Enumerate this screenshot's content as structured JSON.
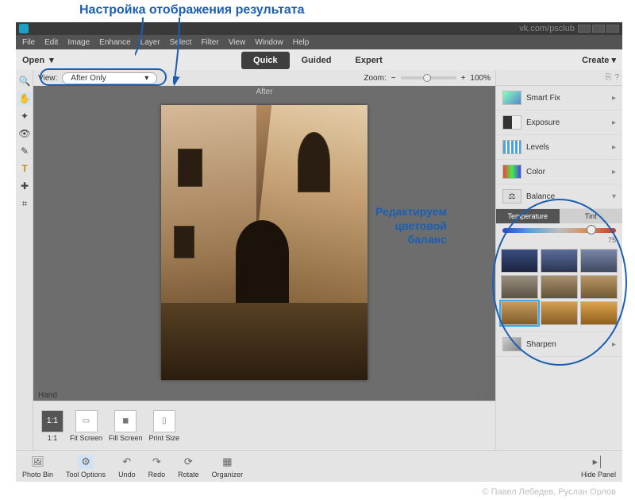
{
  "annotation": {
    "top": "Настройка отображения результата",
    "right_l1": "Редактируем",
    "right_l2": "цветовой",
    "right_l3": "баланс"
  },
  "watermark": "vk.com/psclub",
  "menu": [
    "File",
    "Edit",
    "Image",
    "Enhance",
    "Layer",
    "Select",
    "Filter",
    "View",
    "Window",
    "Help"
  ],
  "modebar": {
    "open": "Open",
    "tabs": [
      "Quick",
      "Guided",
      "Expert"
    ],
    "active": "Quick",
    "create": "Create"
  },
  "viewbar": {
    "label": "View:",
    "value": "After Only",
    "zoom_label": "Zoom:",
    "zoom_value": "100%",
    "after_label": "After"
  },
  "hand_label": "Hand",
  "thumb_bar": {
    "b1": "1:1",
    "b2": "Fit Screen",
    "b3": "Fill Screen",
    "b4": "Print Size"
  },
  "rpanel": {
    "rows": [
      "Smart Fix",
      "Exposure",
      "Levels",
      "Color",
      "Balance",
      "Sharpen"
    ],
    "balance": {
      "tabs": [
        "Temperature",
        "Tint"
      ],
      "value": "75"
    }
  },
  "footer": {
    "b1": "Photo Bin",
    "b2": "Tool Options",
    "b3": "Undo",
    "b4": "Redo",
    "b5": "Rotate",
    "b6": "Organizer",
    "hide": "Hide Panel"
  },
  "credit": "© Павел Лебедев, Руслан Орлов"
}
